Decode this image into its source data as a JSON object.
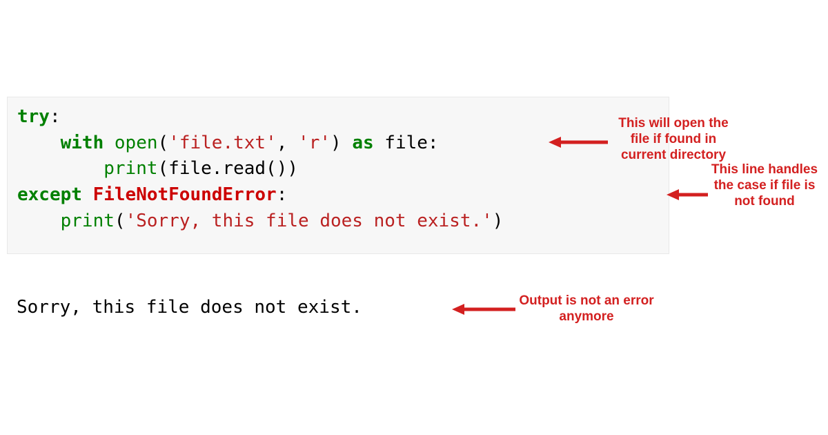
{
  "code": {
    "try_kw": "try",
    "colon": ":",
    "with_kw": "with",
    "open_fn": "open",
    "open_paren": "(",
    "file_arg": "'file.txt'",
    "comma_sp": ", ",
    "mode_arg": "'r'",
    "close_paren": ")",
    "as_kw": "as",
    "file_var": "file",
    "print_fn": "print",
    "file_read": "file.read()",
    "except_kw": "except",
    "error_cls": "FileNotFoundError",
    "error_msg": "'Sorry, this file does not exist.'"
  },
  "output": "Sorry, this file does not exist.",
  "annotations": {
    "a1": "This will open the file if found in current directory",
    "a2": "This line handles the case if file is not found",
    "a3": "Output is not an error anymore"
  },
  "colors": {
    "annot": "#d32020"
  }
}
